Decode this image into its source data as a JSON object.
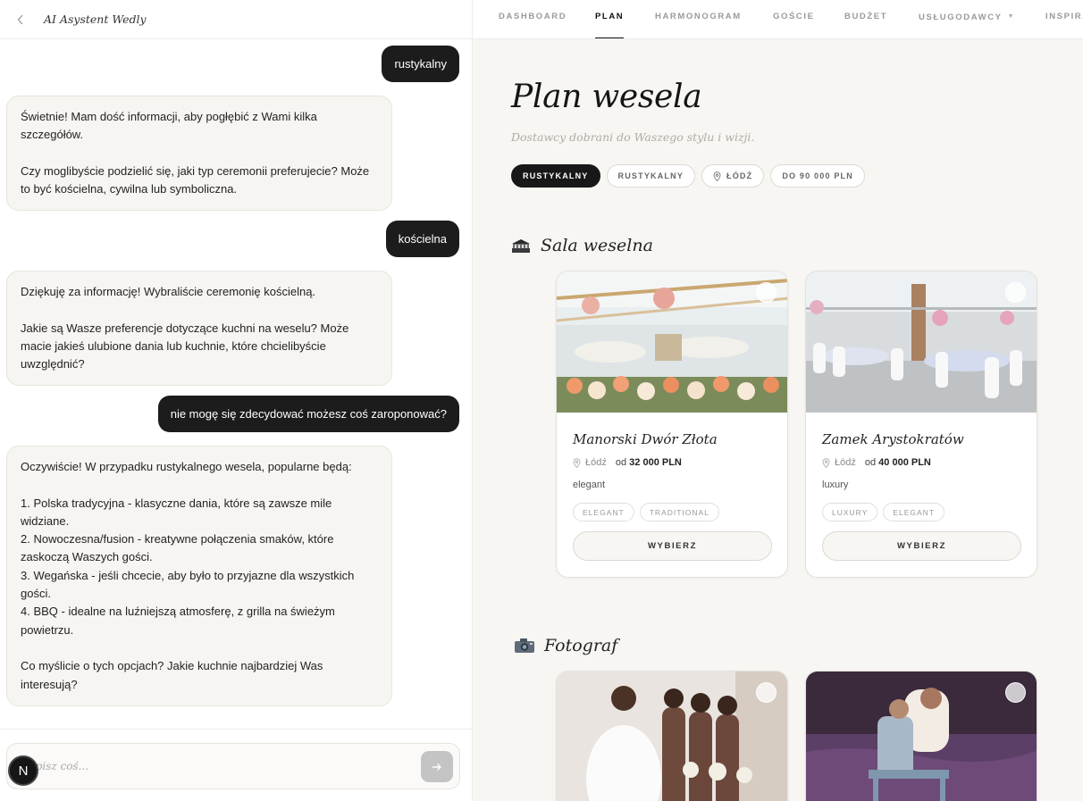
{
  "chat": {
    "title": "AI Asystent Wedly",
    "messages": [
      {
        "role": "user",
        "text": "rustykalny"
      },
      {
        "role": "bot",
        "text": "Świetnie! Mam dość informacji, aby pogłębić z Wami kilka szczegółów.\n\nCzy moglibyście podzielić się, jaki typ ceremonii preferujecie? Może to być kościelna, cywilna lub symboliczna."
      },
      {
        "role": "user",
        "text": "kościelna"
      },
      {
        "role": "bot",
        "text": "Dziękuję za informację! Wybraliście ceremonię kościelną.\n\nJakie są Wasze preferencje dotyczące kuchni na weselu? Może macie jakieś ulubione dania lub kuchnie, które chcielibyście uwzględnić?"
      },
      {
        "role": "user",
        "text": "nie mogę się zdecydować możesz coś zaroponować?"
      },
      {
        "role": "bot",
        "text": "Oczywiście! W przypadku rustykalnego wesela, popularne będą:\n\n1. Polska tradycyjna - klasyczne dania, które są zawsze mile widziane.\n2. Nowoczesna/fusion - kreatywne połączenia smaków, które zaskoczą Waszych gości.\n3. Wegańska - jeśli chcecie, aby było to przyjazne dla wszystkich gości.\n4. BBQ - idealne na luźniejszą atmosferę, z grilla na świeżym powietrzu.\n\nCo myślicie o tych opcjach? Jakie kuchnie najbardziej Was interesują?"
      }
    ],
    "input_placeholder": "Napisz coś...",
    "badge": "N"
  },
  "nav": {
    "items": [
      "Dashboard",
      "Plan",
      "Harmonogram",
      "Goście",
      "Budżet",
      "Usługodawcy",
      "Inspiracje"
    ],
    "active": "Plan"
  },
  "plan": {
    "title": "Plan wesela",
    "subtitle": "Dostawcy dobrani do Waszego stylu i wizji.",
    "filters": [
      "Rustykalny",
      "Rustykalny",
      "Łódź",
      "Do 90 000 PLN"
    ]
  },
  "sections": [
    {
      "title": "Sala weselna",
      "icon": "venue-icon",
      "cards": [
        {
          "name": "Manorski Dwór Złota",
          "city": "Łódź",
          "price_prefix": "od",
          "price": "32 000 PLN",
          "style": "elegant",
          "tags": [
            "Elegant",
            "Traditional"
          ],
          "button": "Wybierz"
        },
        {
          "name": "Zamek Arystokratów",
          "city": "Łódź",
          "price_prefix": "od",
          "price": "40 000 PLN",
          "style": "luxury",
          "tags": [
            "Luxury",
            "Elegant"
          ],
          "button": "Wybierz"
        }
      ]
    },
    {
      "title": "Fotograf",
      "icon": "camera-icon",
      "cards": []
    }
  ],
  "colors": {
    "accent_dark": "#1c1c1c",
    "panel_bg": "#f7f6f3",
    "bubble_bg": "#f7f5f1"
  }
}
